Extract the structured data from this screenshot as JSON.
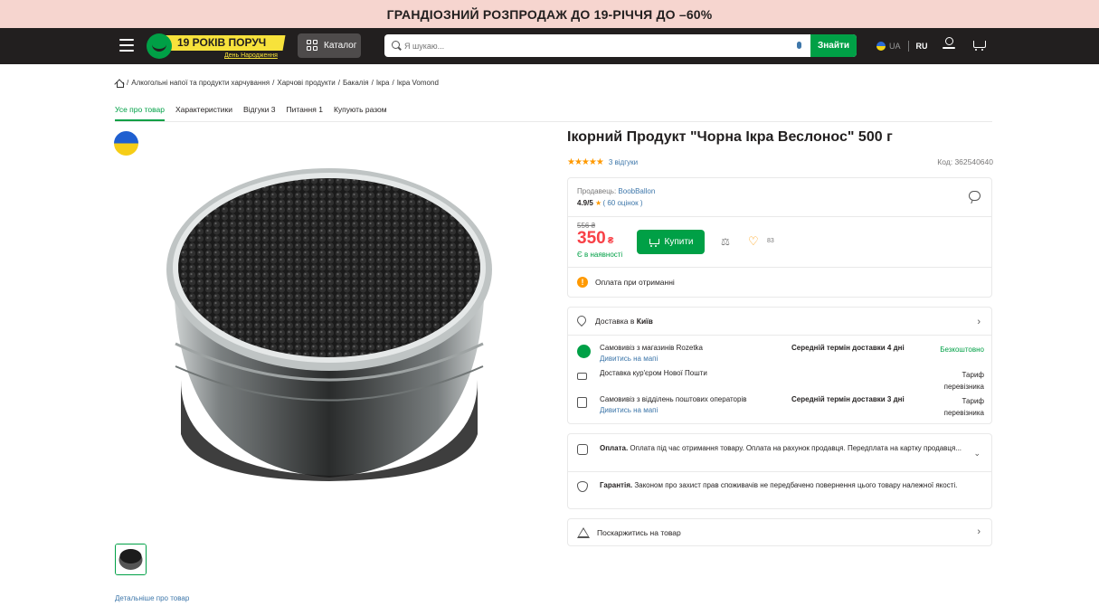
{
  "promo": {
    "text": "ГРАНДІОЗНИЙ РОЗПРОДАЖ ДО 19-РІЧЧЯ ДО –60%"
  },
  "header": {
    "logo_text": "19 РОКІВ ПОРУЧ",
    "logo_sub": "День Народження",
    "catalog_label": "Каталог",
    "search_placeholder": "Я шукаю...",
    "search_button": "Знайти",
    "lang_ua": "UA",
    "lang_ru": "RU"
  },
  "breadcrumbs": [
    "Алкогольні напої та продукти харчування",
    "Харчові продукти",
    "Бакалія",
    "Ікра",
    "Ікра Vomond"
  ],
  "tabs": [
    {
      "label": "Усе про товар",
      "active": true
    },
    {
      "label": "Характеристики"
    },
    {
      "label": "Відгуки 3"
    },
    {
      "label": "Питання 1"
    },
    {
      "label": "Купують разом"
    }
  ],
  "product": {
    "title": "Ікорний Продукт \"Чорна Ікра Веслонос\" 500 г",
    "rating_stars": 5,
    "reviews_text": "3 відгуки",
    "code": "Код: 362540640",
    "details_link": "Детальніше про товар"
  },
  "seller": {
    "label": "Продавець:",
    "name": "BoobBallon",
    "score": "4.9/5",
    "count": "( 60 оцінок )"
  },
  "price": {
    "old": "556 ₴",
    "current": "350",
    "currency": "₴",
    "availability": "Є в наявності",
    "buy_label": "Купити",
    "wishlist_count": "83"
  },
  "payment_note": "Оплата при отриманні",
  "delivery": {
    "heading_prefix": "Доставка в",
    "city": "Київ",
    "rows": [
      {
        "title": "Самовивіз з магазинів Rozetka",
        "link": "Дивитись на мапі",
        "term": "Середній термін доставки 4 дні",
        "price": "Безкоштовно"
      },
      {
        "title": "Доставка кур'єром Нової Пошти",
        "link": "",
        "term": "",
        "price": "Тариф перевізника"
      },
      {
        "title": "Самовивіз з відділень поштових операторів",
        "link": "Дивитись на мапі",
        "term": "Середній термін доставки 3 дні",
        "price": "Тариф перевізника"
      }
    ]
  },
  "info": {
    "payment_title": "Оплата.",
    "payment_text": "Оплата під час отримання товару. Оплата на рахунок продавця. Передплата на картку продавця...",
    "warranty_title": "Гарантія.",
    "warranty_text": "Законом про захист прав споживачів не передбачено повернення цього товару належної якості."
  },
  "complain": "Поскаржитись на товар",
  "colors": {
    "accent": "#00a046",
    "price": "#f84147",
    "link": "#3e77aa",
    "header": "#221f1f",
    "promo_bg": "#f6d5cf"
  }
}
